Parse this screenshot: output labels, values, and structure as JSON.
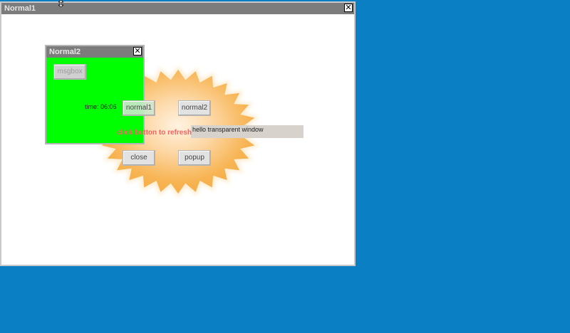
{
  "desktop": {
    "background": "#0a7fc4"
  },
  "window1": {
    "title": "Normal1",
    "close_glyph": "✕"
  },
  "window2": {
    "title": "Normal2",
    "close_glyph": "✕",
    "background": "#00ff00",
    "msgbox_label": "msgbox"
  },
  "main": {
    "time_label": "time: 06:06",
    "normal1_label": "normal1",
    "normal2_label": "normal2",
    "close_label": "close",
    "popup_label": "popup",
    "refresh_text": "click button to refresh",
    "hello_text": "hello transparent window",
    "accent": "#f06464",
    "starburst_color": "#f7b04a"
  },
  "cursor": {
    "icon": "resize-vertical-cursor-icon"
  }
}
